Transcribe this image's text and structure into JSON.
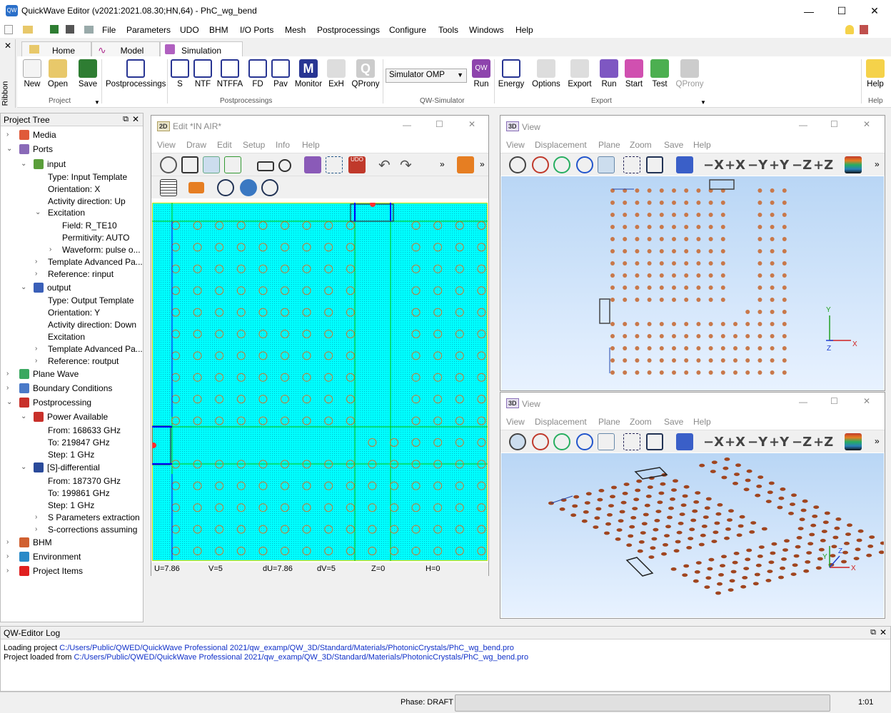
{
  "app": {
    "title": "QuickWave Editor (v2021:2021.08.30;HN,64) - PhC_wg_bend",
    "minimize": "—",
    "maximize": "☐",
    "close": "✕"
  },
  "menu": [
    "File",
    "Parameters",
    "UDO",
    "BHM",
    "I/O Ports",
    "Mesh",
    "Postprocessings",
    "Configure",
    "Tools",
    "Windows",
    "Help"
  ],
  "ribbon": {
    "side_label": "Ribbon",
    "close": "✕",
    "tabs": [
      "Home",
      "Model",
      "Simulation"
    ],
    "buttons": [
      "New",
      "Open",
      "Save",
      "Postprocessings",
      "S",
      "NTF",
      "NTFFA",
      "FD",
      "Pav",
      "Monitor",
      "ExH",
      "QProny",
      "Run",
      "Energy",
      "Options",
      "Export",
      "Run",
      "Start",
      "Test",
      "QProny",
      "Help"
    ],
    "simulator": "Simulator OMP",
    "groups": [
      "Project",
      "Postprocessings",
      "QW-Simulator",
      "Export",
      "Help"
    ]
  },
  "tree": {
    "title": "Project Tree",
    "items": [
      "Media",
      "Ports",
      "input",
      "Type: Input Template",
      "Orientation: X",
      "Activity direction: Up",
      "Excitation",
      "Field: R_TE10",
      "Permitivity: AUTO",
      "Waveform: pulse o...",
      "Template Advanced Pa...",
      "Reference: rinput",
      "output",
      "Type: Output Template",
      "Orientation: Y",
      "Activity direction: Down",
      "Excitation",
      "Template Advanced Pa...",
      "Reference: routput",
      "Plane Wave",
      "Boundary Conditions",
      "Postprocessing",
      "Power Available",
      "From: 168633 GHz",
      "To: 219847 GHz",
      "Step: 1 GHz",
      "[S]-differential",
      "From: 187370 GHz",
      "To: 199861 GHz",
      "Step: 1 GHz",
      "S Parameters extraction",
      "S-corrections assuming",
      "BHM",
      "Environment",
      "Project Items"
    ]
  },
  "edit": {
    "badge": "2D",
    "title": "Edit  *IN AIR*",
    "menu": [
      "View",
      "Draw",
      "Edit",
      "Setup",
      "Info",
      "Help"
    ],
    "status": [
      "U=7.86",
      "V=5",
      "dU=7.86",
      "dV=5",
      "Z=0",
      "H=0"
    ]
  },
  "view1": {
    "badge": "3D",
    "title": "View",
    "menu": [
      "View",
      "Displacement",
      "Plane",
      "Zoom",
      "Save",
      "Help"
    ],
    "axis_buttons": [
      "−X",
      "+X",
      "−Y",
      "+Y",
      "−Z",
      "+Z"
    ],
    "axes": [
      "Y",
      "Z",
      "X"
    ]
  },
  "view2": {
    "badge": "3D",
    "title": "View",
    "menu": [
      "View",
      "Displacement",
      "Plane",
      "Zoom",
      "Save",
      "Help"
    ],
    "axis_buttons": [
      "−X",
      "+X",
      "−Y",
      "+Y",
      "−Z",
      "+Z"
    ],
    "axes": [
      "Y",
      "Z",
      "X"
    ]
  },
  "log": {
    "title": "QW-Editor Log",
    "lines": [
      {
        "prefix": "Loading project ",
        "path": "C:/Users/Public/QWED/QuickWave Professional 2021/qw_examp/QW_3D/Standard/Materials/PhotonicCrystals/PhC_wg_bend.pro"
      },
      {
        "prefix": "Project loaded from ",
        "path": "C:/Users/Public/QWED/QuickWave Professional 2021/qw_examp/QW_3D/Standard/Materials/PhotonicCrystals/PhC_wg_bend.pro"
      }
    ]
  },
  "status": {
    "phase": "Phase: DRAFT",
    "time": "1:01"
  },
  "colors": {
    "canvas": "#00ffff",
    "grid_line": "#00c800",
    "rod": "#c87832",
    "link": "#0000ff",
    "view_bg": "#d4e8ff"
  }
}
